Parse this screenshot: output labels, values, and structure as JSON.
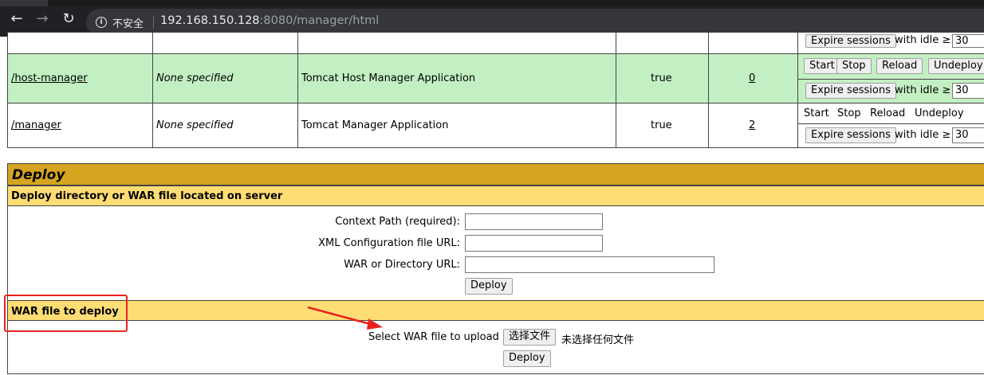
{
  "browser": {
    "back_icon": "←",
    "forward_icon": "→",
    "reload_icon": "↻",
    "info_icon": "i",
    "security_text": "不安全",
    "url_host": "192.168.150.128",
    "url_rest": ":8080/manager/html"
  },
  "applications": {
    "partial_row": {
      "expire_label": "Expire sessions",
      "idle_label": "with idle ≥",
      "idle_value": "30"
    },
    "rows": [
      {
        "path": "/host-manager",
        "version": "None specified",
        "display_name": "Tomcat Host Manager Application",
        "running": "true",
        "sessions": "0",
        "commands": [
          "Start",
          "Stop",
          "Reload",
          "Undeploy"
        ],
        "expire_label": "Expire sessions",
        "idle_label": "with idle ≥",
        "idle_value": "30"
      },
      {
        "path": "/manager",
        "version": "None specified",
        "display_name": "Tomcat Manager Application",
        "running": "true",
        "sessions": "2",
        "commands": [
          "Start",
          "Stop",
          "Reload",
          "Undeploy"
        ],
        "expire_label": "Expire sessions",
        "idle_label": "with idle ≥",
        "idle_value": "30"
      }
    ]
  },
  "deploy": {
    "title": "Deploy",
    "server_section": {
      "header": "Deploy directory or WAR file located on server",
      "context_path_label": "Context Path (required):",
      "context_path_value": "",
      "xml_config_label": "XML Configuration file URL:",
      "xml_config_value": "",
      "war_dir_label": "WAR or Directory URL:",
      "war_dir_value": "",
      "deploy_button": "Deploy"
    },
    "war_section": {
      "header": "WAR file to deploy",
      "select_label": "Select WAR file to upload",
      "choose_file_button": "选择文件",
      "no_file_text": "未选择任何文件",
      "deploy_button": "Deploy"
    }
  },
  "colors": {
    "running_row_bg": "#c3f0c3",
    "deploy_title_bg": "#d5a521",
    "section_header_bg": "#ffdd75",
    "annotation_red": "#e8231f"
  }
}
